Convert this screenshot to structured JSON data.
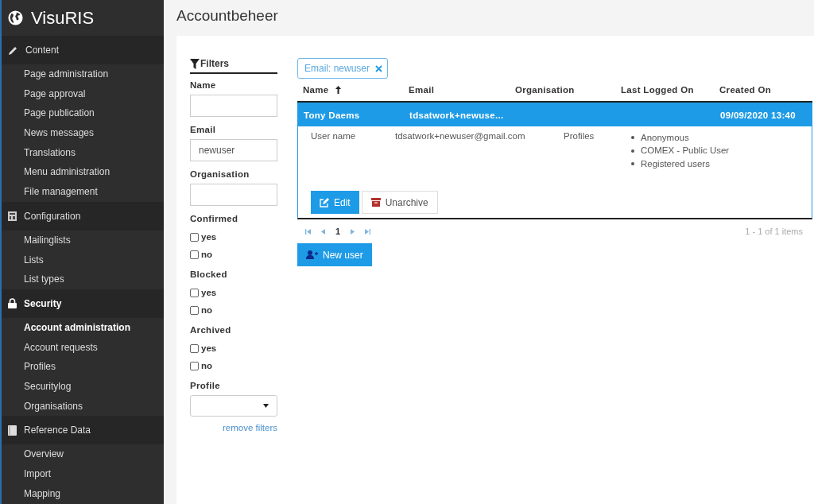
{
  "app": {
    "name": "VisuRIS"
  },
  "sidebar": {
    "sections": [
      {
        "label": "Content",
        "selected": false,
        "items": [
          {
            "label": "Page administration",
            "selected": false
          },
          {
            "label": "Page approval",
            "selected": false
          },
          {
            "label": "Page publication",
            "selected": false
          },
          {
            "label": "News messages",
            "selected": false
          },
          {
            "label": "Translations",
            "selected": false
          },
          {
            "label": "Menu administration",
            "selected": false
          },
          {
            "label": "File management",
            "selected": false
          }
        ]
      },
      {
        "label": "Configuration",
        "selected": false,
        "items": [
          {
            "label": "Mailinglists",
            "selected": false
          },
          {
            "label": "Lists",
            "selected": false
          },
          {
            "label": "List types",
            "selected": false
          }
        ]
      },
      {
        "label": "Security",
        "selected": true,
        "items": [
          {
            "label": "Account administration",
            "selected": true
          },
          {
            "label": "Account requests",
            "selected": false
          },
          {
            "label": "Profiles",
            "selected": false
          },
          {
            "label": "Securitylog",
            "selected": false
          },
          {
            "label": "Organisations",
            "selected": false
          }
        ]
      },
      {
        "label": "Reference Data",
        "selected": false,
        "items": [
          {
            "label": "Overview",
            "selected": false
          },
          {
            "label": "Import",
            "selected": false
          },
          {
            "label": "Mapping",
            "selected": false
          }
        ]
      }
    ]
  },
  "page": {
    "title": "Accountbeheer"
  },
  "filters": {
    "title": "Filters",
    "groups": [
      {
        "kind": "text",
        "label": "Name"
      },
      {
        "kind": "text",
        "label": "Email",
        "value": "newuser"
      },
      {
        "kind": "text",
        "label": "Organisation"
      },
      {
        "kind": "checks",
        "label": "Confirmed",
        "options": [
          {
            "label": "yes",
            "checked": false
          },
          {
            "label": "no",
            "checked": false
          }
        ]
      },
      {
        "kind": "checks",
        "label": "Blocked",
        "options": [
          {
            "label": "yes",
            "checked": false
          },
          {
            "label": "no",
            "checked": false
          }
        ]
      },
      {
        "kind": "checks",
        "label": "Archived",
        "options": [
          {
            "label": "yes",
            "checked": false
          },
          {
            "label": "no",
            "checked": false
          }
        ]
      },
      {
        "kind": "select",
        "label": "Profile"
      }
    ],
    "remove_link": "remove filters"
  },
  "active_filters": [
    {
      "label": "Email: newuser"
    }
  ],
  "table": {
    "columns": [
      {
        "label": "Name",
        "sorted": true
      },
      {
        "label": "Email",
        "sorted": false
      },
      {
        "label": "Organisation",
        "sorted": false
      },
      {
        "label": "Last Logged On",
        "sorted": false
      },
      {
        "label": "Created On",
        "sorted": false
      }
    ],
    "rows": [
      {
        "selected": true,
        "cells": [
          "Tony Daems",
          "tdsatwork+newuse...",
          "",
          "",
          "09/09/2020 13:40"
        ],
        "detail": {
          "user_name_label": "User name",
          "email": "tdsatwork+newuser@gmail.com",
          "profiles_label": "Profiles",
          "profiles": [
            "Anonymous",
            "COMEX - Public User",
            "Registered users"
          ],
          "buttons": [
            {
              "label": "Edit",
              "kind": "primary"
            },
            {
              "label": "Unarchive",
              "kind": "secondary"
            }
          ]
        }
      }
    ]
  },
  "pager": {
    "page": "1",
    "info": "1 - 1 of 1 items"
  },
  "new_button": "New user"
}
